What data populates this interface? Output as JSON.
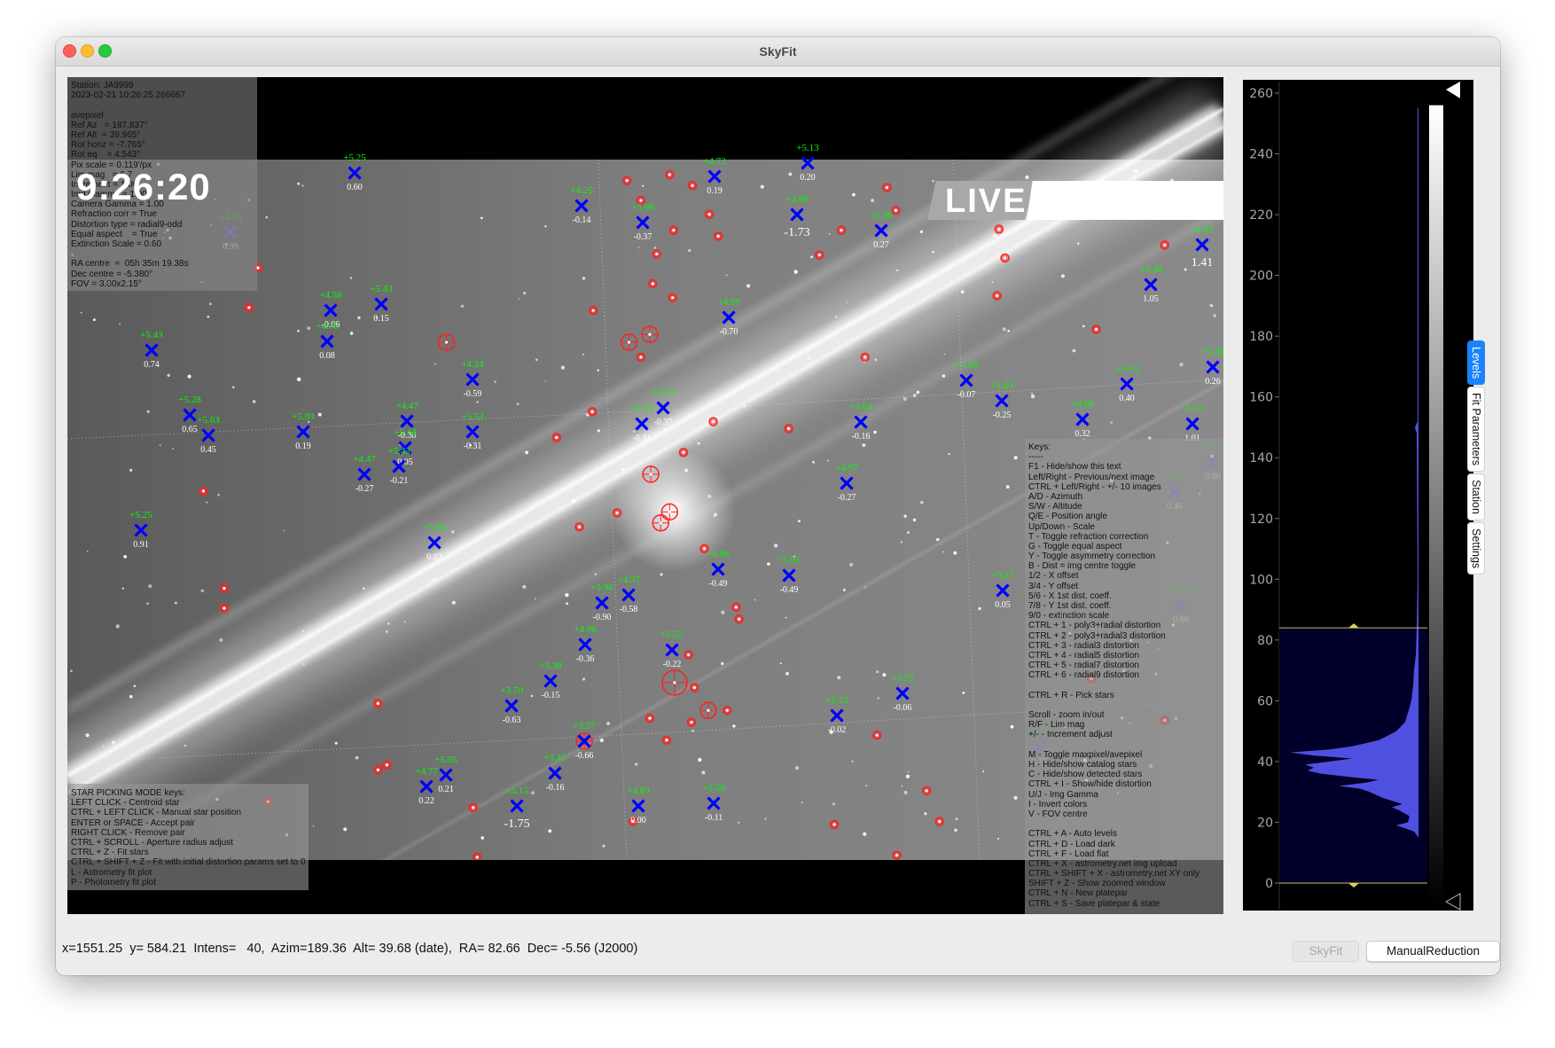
{
  "window": {
    "title": "SkyFit"
  },
  "info_panel": {
    "lines": [
      "Station: JA9999",
      "2023-02-21 10:26:25.266667",
      "",
      "avepixel",
      "Ref Az   = 187.837°",
      "Ref Alt  = 39.965°",
      "Rot horiz = -7.765°",
      "Rot eq    = 4.543°",
      "Pix scale = 0.119'/px",
      "Lim mag   = 6.7",
      "Increment = 1.00",
      "Img Gamma = 1.00",
      "Camera Gamma = 1.00",
      "Refraction corr = True",
      "Distortion type = radial9-odd",
      "Equal aspect    = True",
      "Extinction Scale = 0.60",
      "",
      "RA centre  =  05h 35m 19.38s",
      "Dec centre = -5.380°",
      "FOV = 3.80x2.15°"
    ]
  },
  "overlay": {
    "clock": "9:26:20",
    "live": "LIVE"
  },
  "keys_panel": {
    "lines": [
      "Keys:",
      "-----",
      "F1 - Hide/show this text",
      "Left/Right - Previous/next image",
      "CTRL + Left/Right - +/- 10 images",
      "A/D - Azimuth",
      "S/W - Altitude",
      "Q/E - Position angle",
      "Up/Down - Scale",
      "T - Toggle refraction correction",
      "G - Toggle equal aspect",
      "Y - Toggle asymmetry correction",
      "B - Dist = img centre toggle",
      "1/2 - X offset",
      "3/4 - Y offset",
      "5/6 - X 1st dist. coeff.",
      "7/8 - Y 1st dist. coeff.",
      "9/0 - extinction scale",
      "CTRL + 1 - poly3+radial distortion",
      "CTRL + 2 - poly3+radial3 distortion",
      "CTRL + 3 - radial3 distortion",
      "CTRL + 4 - radial5 distortion",
      "CTRL + 5 - radial7 distortion",
      "CTRL + 6 - radial9 distortion",
      "",
      "CTRL + R - Pick stars",
      "",
      "Scroll - zoom in/out",
      "R/F - Lim mag",
      "+/- - Increment adjust",
      "",
      "M - Toggle maxpixel/avepixel",
      "H - Hide/show catalog stars",
      "C - Hide/show detected stars",
      "CTRL + I - Show/hide distortion",
      "U/J - Img Gamma",
      "I - Invert colors",
      "V - FOV centre",
      "",
      "CTRL + A - Auto levels",
      "CTRL + D - Load dark",
      "CTRL + F - Load flat",
      "CTRL + X - astrometry.net img upload",
      "CTRL + SHIFT + X - astrometry.net XY only",
      "SHIFT + Z - Show zoomed window",
      "CTRL + N - New platepar",
      "CTRL + S - Save platepar & state"
    ]
  },
  "picking_panel": {
    "lines": [
      "STAR PICKING MODE keys:",
      "LEFT CLICK - Centroid star",
      "CTRL + LEFT CLICK - Manual star position",
      "ENTER or SPACE - Accept pair",
      "RIGHT CLICK - Remove pair",
      "CTRL + SCROLL - Aperture radius adjust",
      "CTRL + Z - Fit stars",
      "CTRL + SHIFT + Z - Fit with initial distortion params set to 0",
      "L - Astrometry fit plot",
      "P - Photometry fit plot"
    ]
  },
  "catalog_stars": [
    {
      "mag": "+5.25",
      "val": "0.60"
    },
    {
      "mag": "+4.70",
      "val": "0.99"
    },
    {
      "mag": "+4.25",
      "val": "-0.14"
    },
    {
      "mag": "+5.98",
      "val": "-0.37"
    },
    {
      "mag": "+4.58",
      "val": "-0.06"
    },
    {
      "mag": "+5.43",
      "val": "0.15"
    },
    {
      "mag": "+4.78",
      "val": "0.08"
    },
    {
      "mag": "+5.43",
      "val": "0.74"
    },
    {
      "mag": "+4.24",
      "val": "-0.59"
    },
    {
      "mag": "+5.28",
      "val": "0.65"
    },
    {
      "mag": "+5.63",
      "val": "0.45"
    },
    {
      "mag": "+5.03",
      "val": "0.19"
    },
    {
      "mag": "+4.47",
      "val": "-0.30"
    },
    {
      "mag": "+5.18",
      "val": "0.05"
    },
    {
      "mag": "+5.43",
      "val": "-0.21"
    },
    {
      "mag": "+4.47",
      "val": "-0.27"
    },
    {
      "mag": "+5.53",
      "val": "-0.31"
    },
    {
      "mag": "+5.33",
      "val": "-0.31"
    },
    {
      "mag": "+4.72",
      "val": "0.19"
    },
    {
      "mag": "+5.13",
      "val": "0.20"
    },
    {
      "mag": "+4.98",
      "val": "-1.73"
    },
    {
      "mag": "+5.06",
      "val": "0.27"
    },
    {
      "mag": "+4.41",
      "val": "1.41"
    },
    {
      "mag": "+5.38",
      "val": "1.05"
    },
    {
      "mag": "+4.09",
      "val": "-0.70"
    },
    {
      "mag": "+5.33",
      "val": "-0.37"
    },
    {
      "mag": "+5.64",
      "val": "-0.16"
    },
    {
      "mag": "+5.36",
      "val": "-0.07"
    },
    {
      "mag": "+5.43",
      "val": "-0.25"
    },
    {
      "mag": "+5.53",
      "val": "0.40"
    },
    {
      "mag": "+5.36",
      "val": "0.26"
    },
    {
      "mag": "+4.98",
      "val": "0.32"
    },
    {
      "mag": "+5.51",
      "val": "1.01"
    },
    {
      "mag": "+4.59",
      "val": "0.80"
    },
    {
      "mag": "+4.20",
      "val": "0.46"
    },
    {
      "mag": "+4.97",
      "val": "-0.27"
    },
    {
      "mag": "+5.25",
      "val": "0.91"
    },
    {
      "mag": "+5.58",
      "val": "0.03"
    },
    {
      "mag": "+3.96",
      "val": "-0.90"
    },
    {
      "mag": "+4.37",
      "val": "-0.58"
    },
    {
      "mag": "+4.96",
      "val": "-0.36"
    },
    {
      "mag": "+5.38",
      "val": "-0.15"
    },
    {
      "mag": "+3.70",
      "val": "-0.63"
    },
    {
      "mag": "+3.57",
      "val": "-0.66"
    },
    {
      "mag": "+5.05",
      "val": "0.21"
    },
    {
      "mag": "+4.77",
      "val": "0.22"
    },
    {
      "mag": "+5.47",
      "val": "-0.16"
    },
    {
      "mag": "+5.15",
      "val": "-1.75"
    },
    {
      "mag": "+4.83",
      "val": "0.00"
    },
    {
      "mag": "+4.66",
      "val": "-0.49"
    },
    {
      "mag": "+5.01",
      "val": "-0.49"
    },
    {
      "mag": "+5.52",
      "val": "-0.22"
    },
    {
      "mag": "+5.27",
      "val": "0.05"
    },
    {
      "mag": "+5.25",
      "val": "-0.06"
    },
    {
      "mag": "+5.53",
      "val": "-0.02"
    },
    {
      "mag": "+5.50",
      "val": "-0.11"
    },
    {
      "mag": "+4.66",
      "val": "0.86"
    },
    {
      "mag": "+4.76",
      "val": "0.77"
    }
  ],
  "levels": {
    "ticks": [
      "260",
      "240",
      "220",
      "200",
      "180",
      "160",
      "140",
      "120",
      "100",
      "80",
      "60",
      "40",
      "20",
      "0"
    ],
    "tick_values": [
      260,
      240,
      220,
      200,
      180,
      160,
      140,
      120,
      100,
      80,
      60,
      40,
      20,
      0
    ],
    "lower_level": 0,
    "upper_level": 84,
    "histogram_color": "#5050e0"
  },
  "tabs": [
    {
      "label": "Levels",
      "active": true
    },
    {
      "label": "Fit Parameters",
      "active": false
    },
    {
      "label": "Station",
      "active": false
    },
    {
      "label": "Settings",
      "active": false
    }
  ],
  "status_bar": {
    "text": "x=1551.25  y= 584.21  Intens=   40,  Azim=189.36  Alt= 39.68 (date),  RA= 82.66  Dec= -5.56 (J2000)"
  },
  "mode_buttons": {
    "skyfit": "SkyFit",
    "manual": "ManualReduction"
  },
  "colors": {
    "catalog_marker": "#0000ff",
    "catalog_mag": "#00ff00",
    "detected": "#ff2020",
    "accent": "#1a82fb"
  }
}
